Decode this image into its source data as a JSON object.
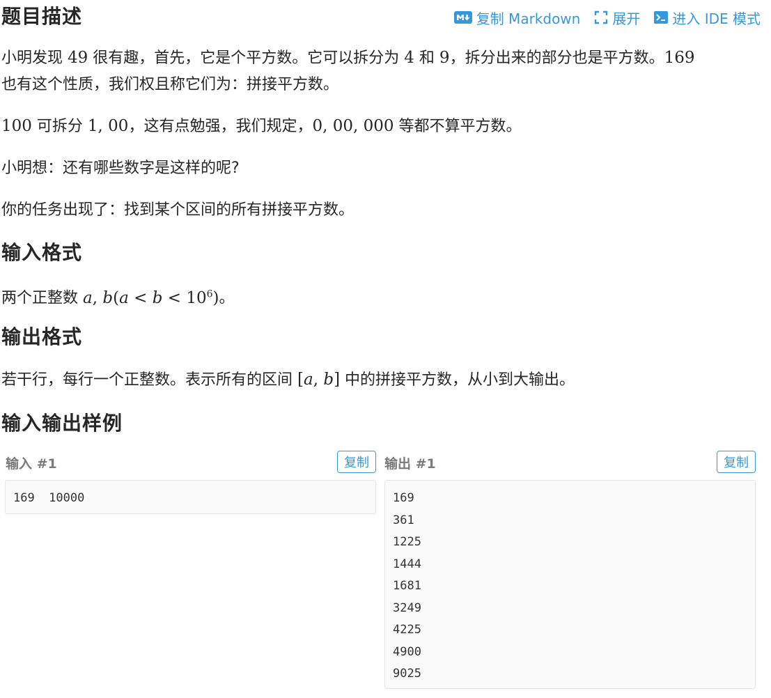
{
  "header": {
    "title": "题目描述",
    "actions": {
      "copy_markdown": "复制 Markdown",
      "expand": "展开",
      "ide_mode": "进入 IDE 模式"
    }
  },
  "description": {
    "p1_a": "小明发现 ",
    "p1_n1": "49",
    "p1_b": " 很有趣，首先，它是个平方数。它可以拆分为 ",
    "p1_n2": "4",
    "p1_c": " 和 ",
    "p1_n3": "9",
    "p1_d": "，拆分出来的部分也是平方数。",
    "p1_n4": "169",
    "p1_e": "也有这个性质，我们权且称它们为：拼接平方数。",
    "p2_n1": "100",
    "p2_a": " 可拆分 ",
    "p2_n2": "1, 00",
    "p2_b": "，这有点勉强，我们规定，",
    "p2_n3": "0, 00, 000",
    "p2_c": " 等都不算平方数。",
    "p3": "小明想：还有哪些数字是这样的呢?",
    "p4": "你的任务出现了：找到某个区间的所有拼接平方数。"
  },
  "input_format": {
    "heading": "输入格式",
    "text_a": "两个正整数 ",
    "math_a": "a",
    "math_comma": ", ",
    "math_b": "b",
    "math_open": "(",
    "math_a2": "a",
    "math_lt1": " < ",
    "math_b2": "b",
    "math_lt2": " < ",
    "math_base": "10",
    "math_exp": "6",
    "math_close": ")",
    "text_b": "。"
  },
  "output_format": {
    "heading": "输出格式",
    "text_a": "若干行，每行一个正整数。表示所有的区间 ",
    "math_open": "[",
    "math_a": "a",
    "math_comma": ", ",
    "math_b": "b",
    "math_close": "]",
    "text_b": " 中的拼接平方数，从小到大输出。"
  },
  "samples": {
    "heading": "输入输出样例",
    "input": {
      "label": "输入 #1",
      "copy": "复制",
      "lines": [
        "169  10000"
      ]
    },
    "output": {
      "label": "输出 #1",
      "copy": "复制",
      "lines": [
        "169",
        "361",
        "1225",
        "1444",
        "1681",
        "3249",
        "4225",
        "4900",
        "9025"
      ]
    }
  },
  "colors": {
    "accent": "#3498db",
    "text": "#262626",
    "code_bg": "#fafafa"
  }
}
